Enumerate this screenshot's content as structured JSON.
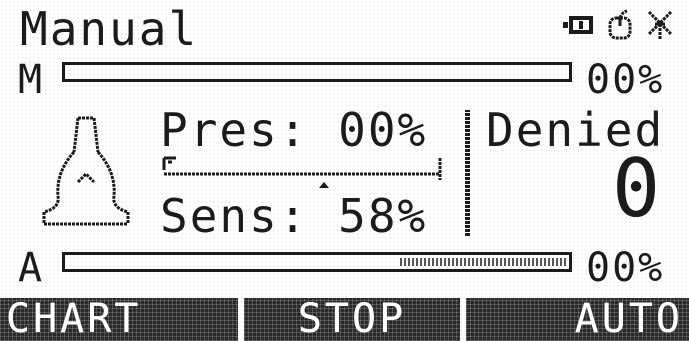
{
  "header": {
    "title": "Manual",
    "icons": [
      "battery-icon",
      "mouse-icon",
      "antenna-icon"
    ]
  },
  "manual_bar": {
    "label": "M",
    "percent_text": "00%",
    "level": 0
  },
  "pressure": {
    "line": "Pres:  00%",
    "value": 0
  },
  "sensitivity": {
    "line": "Sens:  58%",
    "value": 58
  },
  "access": {
    "status": "Denied",
    "digit": "0"
  },
  "auto_bar": {
    "label": "A",
    "percent_text": "00%",
    "level": 0,
    "preset_level": 0.33
  },
  "softkeys": {
    "left": "CHART",
    "center": "STOP",
    "right": "AUTO"
  },
  "colors": {
    "ink": "#1b1b1b",
    "softkey_bg": "#2a2a2a"
  }
}
